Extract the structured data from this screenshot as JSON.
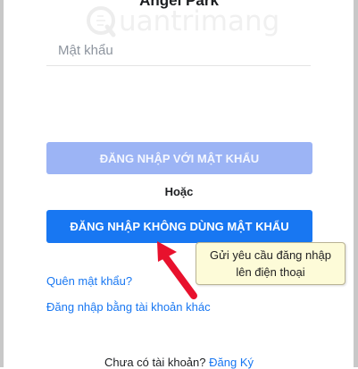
{
  "account": {
    "name": "Angel Park"
  },
  "watermark": {
    "text": "uantrimang"
  },
  "password": {
    "placeholder": "Mật khẩu",
    "value": ""
  },
  "buttons": {
    "login_with_password": "ĐĂNG NHẬP VỚI MẬT KHẨU",
    "login_without_password": "ĐĂNG NHẬP KHÔNG DÙNG MẬT KHẨU"
  },
  "divider": {
    "text": "Hoặc"
  },
  "tooltip": {
    "line1": "Gửi yêu cầu đăng nhập",
    "line2": "lên điện thoại"
  },
  "links": {
    "forgot_password": "Quên mật khẩu?",
    "other_account": "Đăng nhập bằng tài khoản khác"
  },
  "signup": {
    "prompt": "Chưa có tài khoản?",
    "link": "Đăng Ký"
  },
  "colors": {
    "primary": "#1877f2",
    "primary_disabled": "#9cb4f5",
    "tooltip_bg": "#fdfbd8",
    "annotation_arrow": "#e8112d"
  },
  "icons": {
    "annotation": "red-arrow-icon",
    "logo": "quantrimang-logo-icon"
  }
}
